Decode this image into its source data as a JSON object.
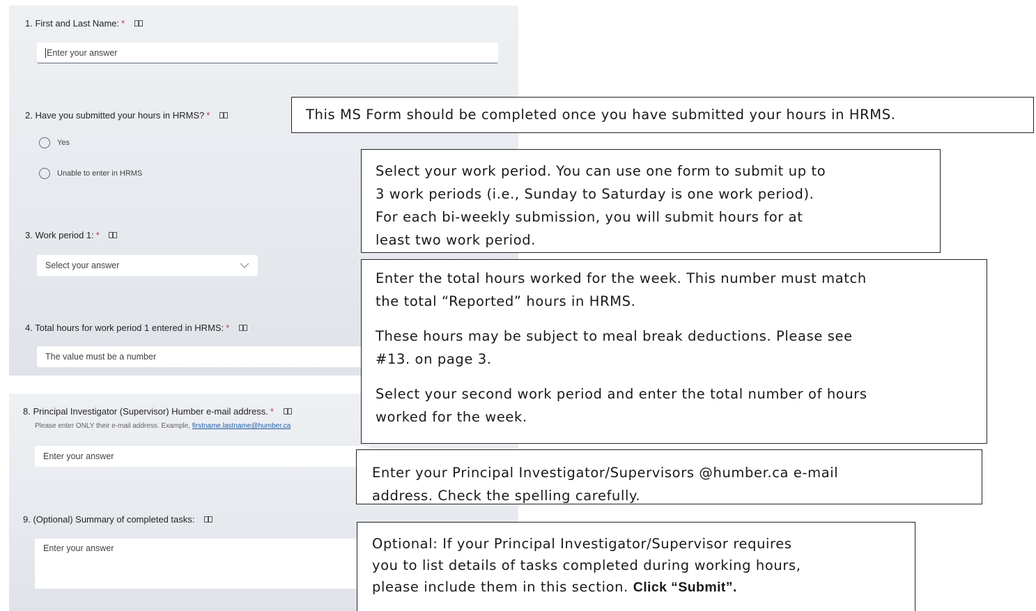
{
  "form": {
    "q1": {
      "label": "1. First and Last Name:",
      "required": "*",
      "placeholder": "Enter your answer"
    },
    "q2": {
      "label": "2. Have you submitted your hours in HRMS?",
      "required": "*",
      "options": [
        "Yes",
        "Unable to enter in HRMS"
      ]
    },
    "q3": {
      "label": "3. Work period 1:",
      "required": "*",
      "placeholder": "Select your answer"
    },
    "q4": {
      "label": "4. Total hours for work period 1 entered in HRMS:",
      "required": "*",
      "placeholder": "The value must be a number"
    },
    "q8": {
      "label": "8. Principal Investigator (Supervisor) Humber e-mail address.",
      "required": "*",
      "hint_prefix": "Please enter ONLY their e-mail address. Example,",
      "hint_link": "firstname.lastname@humber.ca",
      "placeholder": "Enter your answer"
    },
    "q9": {
      "label": "9. (Optional) Summary of completed tasks:",
      "placeholder": "Enter your answer"
    }
  },
  "callouts": {
    "c1": "This MS Form should be completed once you have submitted your hours in HRMS.",
    "c2": [
      "Select your work period. You can use one form to submit up to",
      "3 work periods (i.e., Sunday to Saturday is one work period).",
      "For each bi-weekly submission, you will submit hours for at",
      "least two work period."
    ],
    "c3a": [
      "Enter the total hours worked for the week. This number must match",
      "the total “Reported” hours in HRMS."
    ],
    "c3b": [
      "These hours may be subject to meal break deductions. Please see",
      "#13. on page 3."
    ],
    "c3c": [
      "Select your second work period and enter the total number of hours",
      "worked for the week."
    ],
    "c4": [
      "Enter your Principal Investigator/Supervisors @humber.ca e-mail",
      "address. Check the spelling carefully."
    ],
    "c5": [
      "Optional: If your Principal Investigator/Supervisor requires",
      "you to list details of tasks completed during working hours,",
      "please include them in this section."
    ],
    "c5_bold": "Click “Submit”."
  },
  "icons": {
    "immersive_reader": "immersive-reader-icon",
    "dropdown": "chevron-down-icon"
  },
  "colors": {
    "required_star": "#c4314b",
    "link": "#1f5fa8"
  }
}
